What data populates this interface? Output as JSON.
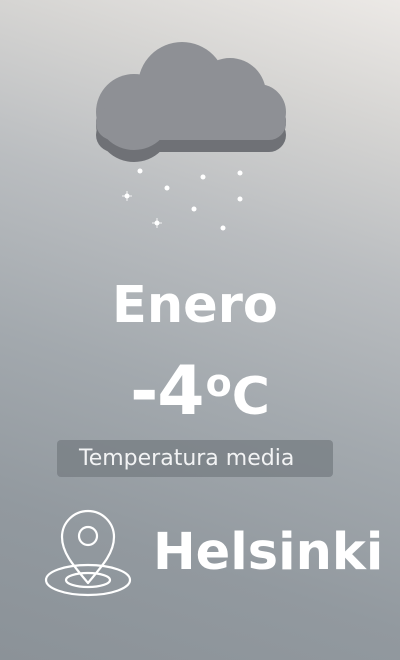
{
  "month": "Enero",
  "temperature": {
    "value": "-4",
    "degree": "o",
    "unit": "C"
  },
  "label": "Temperatura media",
  "city": "Helsinki",
  "icons": {
    "weather": "snow-cloud-icon",
    "location": "map-pin-icon"
  },
  "colors": {
    "text": "#ffffff",
    "pill": "#767c82",
    "cloud": "#8e9095"
  }
}
